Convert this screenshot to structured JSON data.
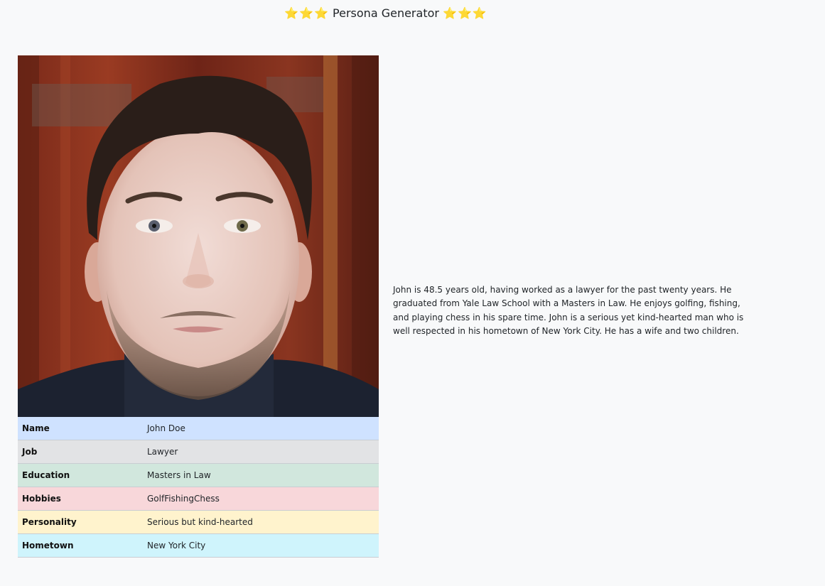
{
  "header": {
    "stars_left": "⭐⭐⭐",
    "title": "Persona Generator",
    "stars_right": "⭐⭐⭐"
  },
  "portrait": {
    "description": "AI-generated portrait photo"
  },
  "info_rows": [
    {
      "key": "Name",
      "value": "John Doe",
      "color": "#cfe2ff"
    },
    {
      "key": "Job",
      "value": "Lawyer",
      "color": "#e2e3e5"
    },
    {
      "key": "Education",
      "value": "Masters in Law",
      "color": "#d1e7dd"
    },
    {
      "key": "Hobbies",
      "value": "GolfFishingChess",
      "color": "#f8d7da"
    },
    {
      "key": "Personality",
      "value": "Serious but kind-hearted",
      "color": "#fff3cd"
    },
    {
      "key": "Hometown",
      "value": "New York City",
      "color": "#cff4fc"
    }
  ],
  "bio": "John is 48.5 years old, having worked as a lawyer for the past twenty years. He graduated from Yale Law School with a Masters in Law. He enjoys golfing, fishing, and playing chess in his spare time. John is a serious yet kind-hearted man who is well respected in his hometown of New York City. He has a wife and two children."
}
